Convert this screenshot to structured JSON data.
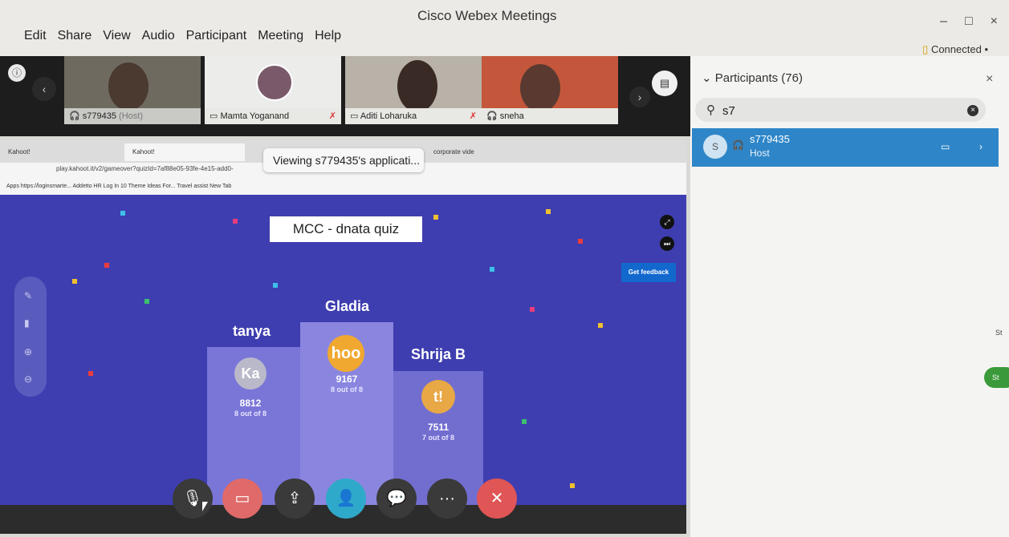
{
  "window": {
    "title": "Cisco Webex Meetings",
    "minimize": "–",
    "maximize": "□",
    "close": "×",
    "status": "Connected"
  },
  "menu": [
    "Edit",
    "Share",
    "View",
    "Audio",
    "Participant",
    "Meeting",
    "Help"
  ],
  "video_tiles": [
    {
      "name": "s779435",
      "suffix": "(Host)"
    },
    {
      "name": "Mamta Yoganand"
    },
    {
      "name": "Aditi Loharuka"
    },
    {
      "name": "sneha"
    }
  ],
  "participants_panel": {
    "title": "Participants (76)",
    "search_value": "s7",
    "host": {
      "initial": "S",
      "name": "s779435",
      "role": "Host"
    }
  },
  "browser": {
    "tabs": [
      "Kahoot!",
      "Kahoot!",
      "corporate vide"
    ],
    "viewing_banner": "Viewing s779435's applicati...",
    "url": "play.kahoot.it/v2/gameover?quizId=7af88e05-93fe-4e15-add0-",
    "bookmarks": "Apps   https://loginsmarte...   Addetto HR   Log In   10 Theme Ideas For...   Travel assist   New Tab"
  },
  "kahoot": {
    "quiz_title": "MCC - dnata quiz",
    "feedback_label": "Get feedback",
    "podium": [
      {
        "rank": 1,
        "name": "Gladia",
        "avatar": "hoo",
        "score": "9167",
        "correct": "8 out of 8",
        "color": "#f0a830"
      },
      {
        "rank": 2,
        "name": "tanya",
        "avatar": "Ka",
        "score": "8812",
        "correct": "8 out of 8",
        "color": "#b9b9c9"
      },
      {
        "rank": 3,
        "name": "Shrija B",
        "avatar": "t!",
        "score": "7511",
        "correct": "7 out of 8",
        "color": "#e8a845"
      }
    ]
  },
  "controls": [
    "mute-icon",
    "video-icon",
    "share-icon",
    "participants-icon",
    "chat-icon",
    "more-icon",
    "leave-icon"
  ],
  "colors": {
    "kahoot_bg": "#3e3eb0",
    "panel_highlight": "#2e86c8",
    "leave_red": "#e05555",
    "video_red": "#e06a6a",
    "participants_teal": "#2fa9c9"
  }
}
